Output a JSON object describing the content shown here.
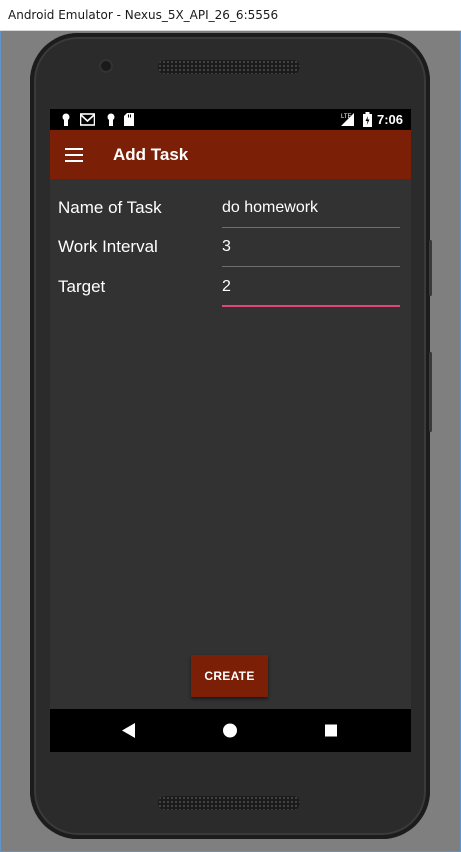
{
  "window": {
    "title": "Android Emulator - Nexus_5X_API_26_6:5556"
  },
  "status_bar": {
    "icons": [
      "notification-icon",
      "gmail-icon",
      "notification-icon",
      "sd-card-icon"
    ],
    "network": "LTE",
    "time": "7:06"
  },
  "app_bar": {
    "title": "Add Task",
    "menu_icon": "hamburger-menu-icon"
  },
  "form": {
    "name": {
      "label": "Name of Task",
      "value": "do homework"
    },
    "interval": {
      "label": "Work Interval",
      "value": "3"
    },
    "target": {
      "label": "Target",
      "value": "2"
    }
  },
  "create_button": {
    "label": "CREATE"
  },
  "nav_bar": {
    "icons": [
      "back-icon",
      "home-icon",
      "recents-icon"
    ]
  },
  "colors": {
    "app_bar": "#7b1f06",
    "screen_bg": "#323232",
    "focus_underline": "#e2457a",
    "button": "#7b1f06"
  }
}
